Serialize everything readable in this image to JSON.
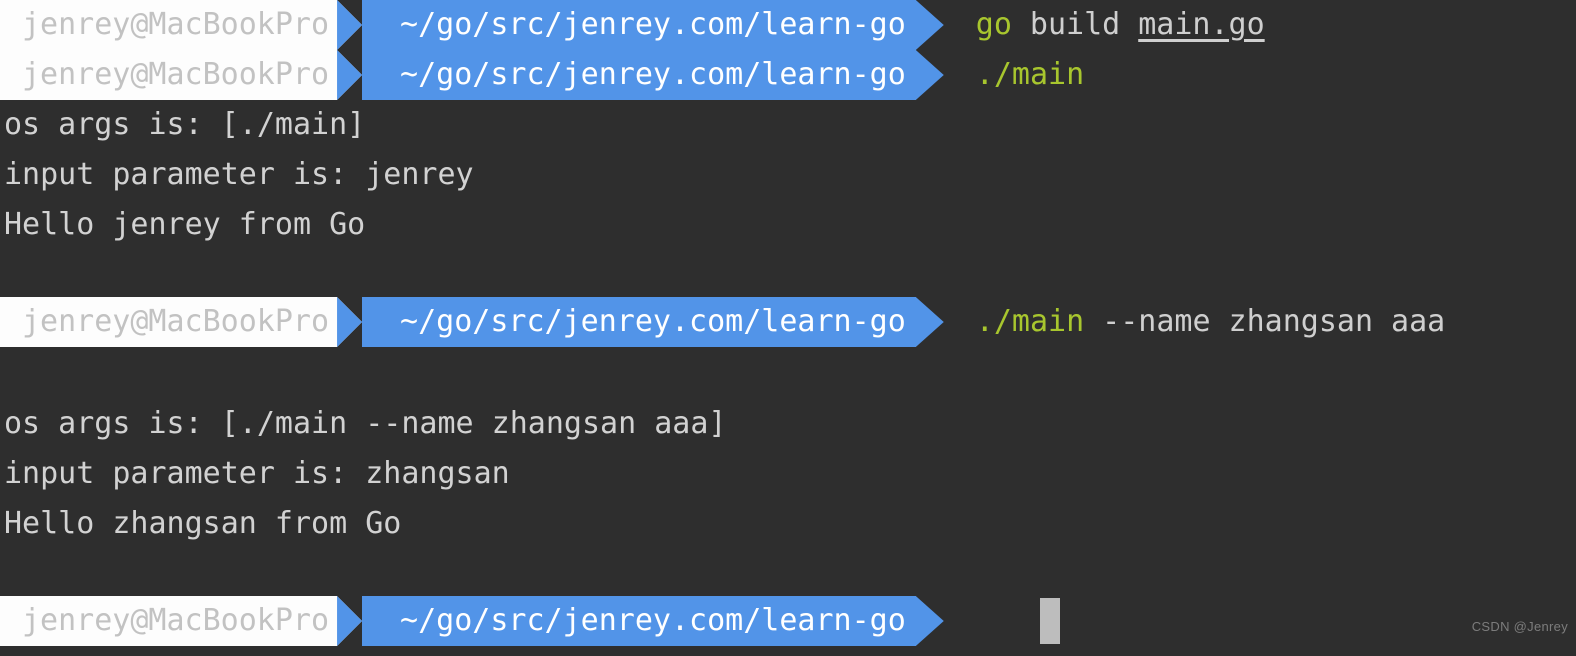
{
  "terminal": {
    "background_color": "#2e2e2e",
    "foreground_color": "#cfcfcf",
    "prompt_host_bg": "#fdfdfd",
    "prompt_host_fg": "#c2c2c2",
    "prompt_path_bg": "#5294e8",
    "prompt_path_fg": "#ffffff",
    "command_accent_color": "#a8c62e"
  },
  "prompts": [
    {
      "host": "jenrey@MacBookPro",
      "path": "~/go/src/jenrey.com/learn-go",
      "command_tokens": [
        {
          "text": "go",
          "style": "green"
        },
        {
          "text": "build",
          "style": "plain"
        },
        {
          "text": "main.go",
          "style": "underline"
        }
      ]
    },
    {
      "host": "jenrey@MacBookPro",
      "path": "~/go/src/jenrey.com/learn-go",
      "command_tokens": [
        {
          "text": "./main",
          "style": "green"
        }
      ]
    },
    {
      "host": "jenrey@MacBookPro",
      "path": "~/go/src/jenrey.com/learn-go",
      "command_tokens": [
        {
          "text": "./main",
          "style": "green"
        },
        {
          "text": "--name",
          "style": "plain"
        },
        {
          "text": "zhangsan",
          "style": "plain"
        },
        {
          "text": "aaa",
          "style": "plain"
        }
      ]
    },
    {
      "host": "jenrey@MacBookPro",
      "path": "~/go/src/jenrey.com/learn-go",
      "command_tokens": []
    }
  ],
  "output_block_1": {
    "line1": "os args is: [./main]",
    "line2": "input parameter is: jenrey",
    "line3": "Hello jenrey from Go"
  },
  "output_block_2": {
    "line1": "os args is: [./main --name zhangsan aaa]",
    "line2": "input parameter is: zhangsan",
    "line3": "Hello zhangsan from Go"
  },
  "cursor": {
    "visible": true,
    "color": "#bdbdbd"
  },
  "watermark": {
    "text": "CSDN @Jenrey"
  }
}
